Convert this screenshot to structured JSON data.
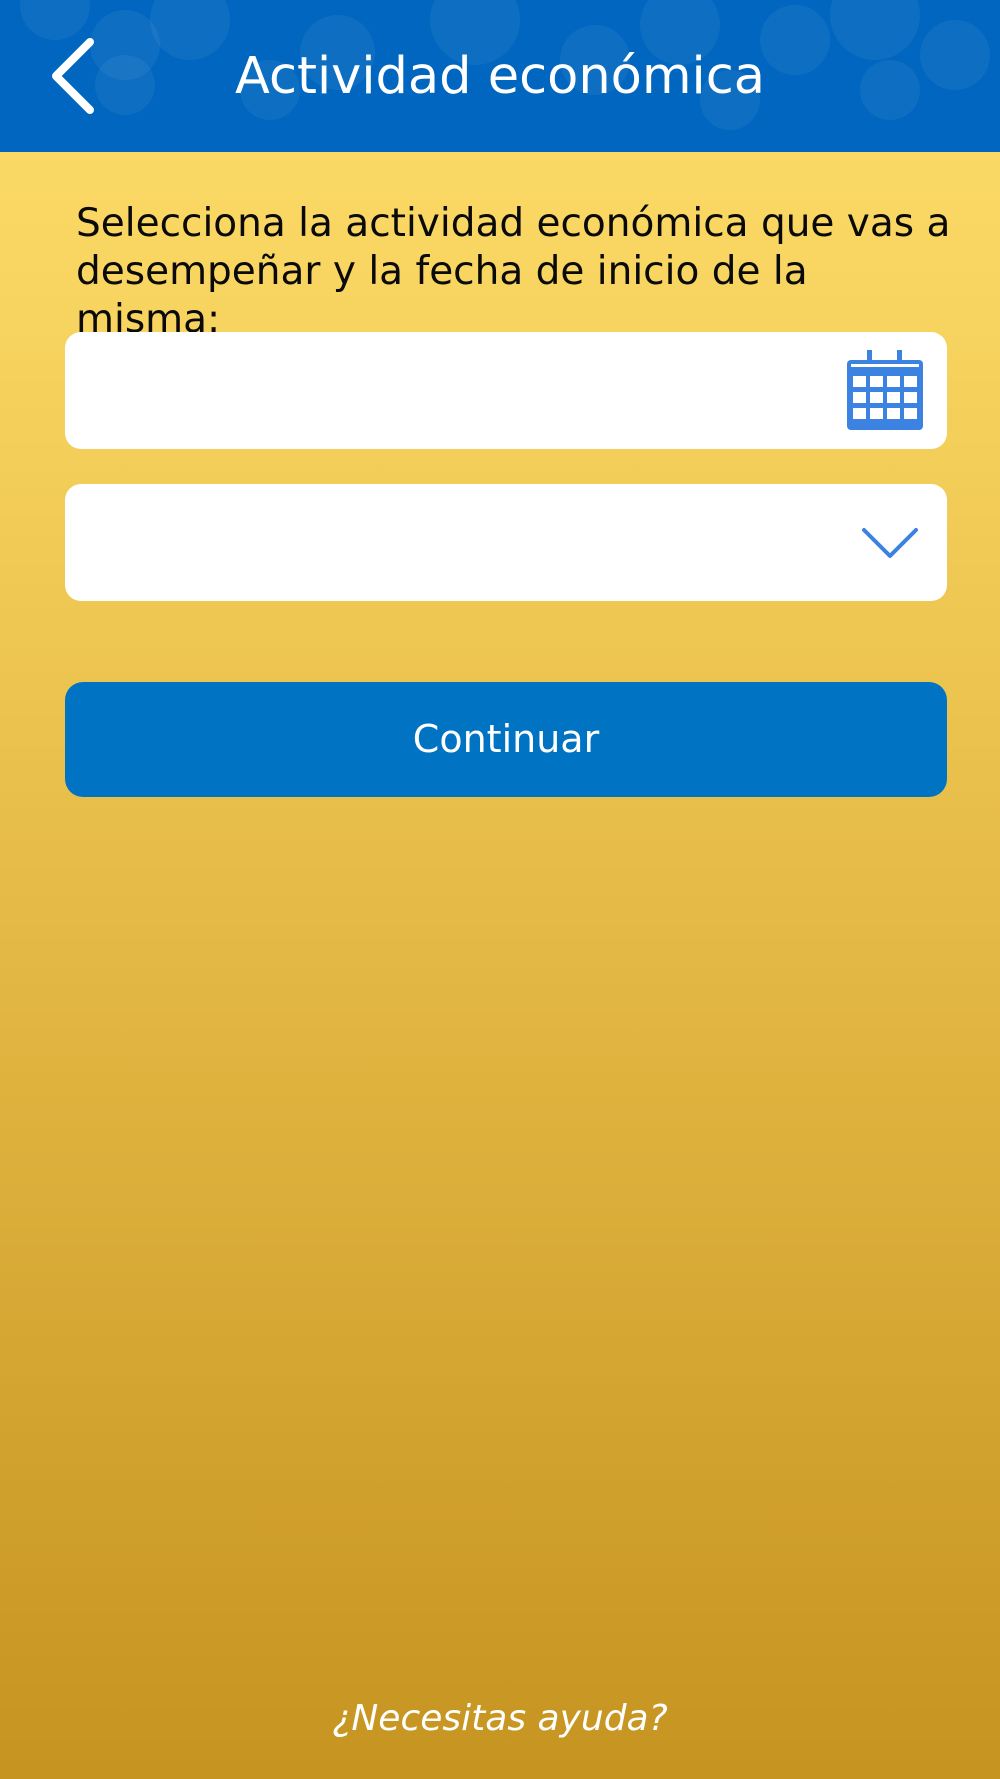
{
  "header": {
    "title": "Actividad económica",
    "back_icon": "chevron-left-icon",
    "background_color": "#0066bf"
  },
  "form": {
    "instructions": "Selecciona la actividad económica que vas a desempeñar y la fecha de inicio de la misma:",
    "date_field": {
      "value": "",
      "icon": "calendar-icon"
    },
    "activity_field": {
      "value": "",
      "icon": "chevron-down-icon"
    }
  },
  "buttons": {
    "continue_label": "Continuar",
    "continue_color": "#0073c2"
  },
  "footer": {
    "help_link": "¿Necesitas ayuda?"
  },
  "colors": {
    "accent_icon": "#3c82e0",
    "background_top": "#fedd6a",
    "background_bottom": "#c69420"
  }
}
